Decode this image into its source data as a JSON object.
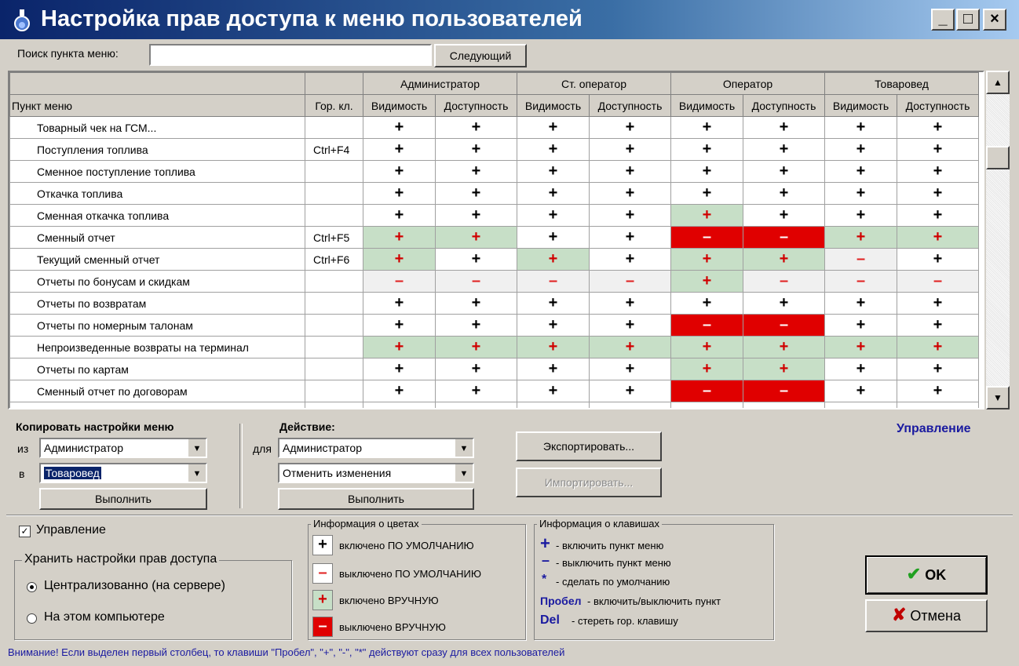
{
  "window": {
    "title": "Настройка прав доступа к меню пользователей",
    "min": "_",
    "max": "□",
    "close": "×"
  },
  "search": {
    "label": "Поиск пункта меню:",
    "value": "",
    "next_button": "Следующий"
  },
  "grid": {
    "col_item": "Пункт меню",
    "col_hotkey": "Гор. кл.",
    "groups": [
      "Администратор",
      "Ст. оператор",
      "Оператор",
      "Товаровед"
    ],
    "sub_vis": "Видимость",
    "sub_acc": "Доступность",
    "rows": [
      {
        "name": "Товарный чек на ГСМ...",
        "hotkey": "",
        "cells": [
          "d+",
          "d+",
          "d+",
          "d+",
          "d+",
          "d+",
          "d+",
          "d+"
        ]
      },
      {
        "name": "Поступления топлива",
        "hotkey": "Ctrl+F4",
        "cells": [
          "d+",
          "d+",
          "d+",
          "d+",
          "d+",
          "d+",
          "d+",
          "d+"
        ]
      },
      {
        "name": "Сменное поступление топлива",
        "hotkey": "",
        "cells": [
          "d+",
          "d+",
          "d+",
          "d+",
          "d+",
          "d+",
          "d+",
          "d+"
        ]
      },
      {
        "name": "Откачка топлива",
        "hotkey": "",
        "cells": [
          "d+",
          "d+",
          "d+",
          "d+",
          "d+",
          "d+",
          "d+",
          "d+"
        ]
      },
      {
        "name": "Сменная откачка топлива",
        "hotkey": "",
        "cells": [
          "d+",
          "d+",
          "d+",
          "d+",
          "m+",
          "d+",
          "d+",
          "d+"
        ]
      },
      {
        "name": "Сменный отчет",
        "hotkey": "Ctrl+F5",
        "cells": [
          "m+",
          "m+",
          "d+",
          "d+",
          "mm",
          "mm",
          "m+",
          "m+"
        ]
      },
      {
        "name": "Текущий сменный отчет",
        "hotkey": "Ctrl+F6",
        "cells": [
          "m+",
          "d+",
          "m+",
          "d+",
          "m+",
          "m+",
          "dm",
          "d+"
        ]
      },
      {
        "name": "Отчеты по бонусам и скидкам",
        "hotkey": "",
        "cells": [
          "dm",
          "dm",
          "dm",
          "dm",
          "m+",
          "dm",
          "dm",
          "dm"
        ]
      },
      {
        "name": "Отчеты по возвратам",
        "hotkey": "",
        "cells": [
          "d+",
          "d+",
          "d+",
          "d+",
          "d+",
          "d+",
          "d+",
          "d+"
        ]
      },
      {
        "name": "Отчеты по номерным талонам",
        "hotkey": "",
        "cells": [
          "d+",
          "d+",
          "d+",
          "d+",
          "mm",
          "mm",
          "d+",
          "d+"
        ]
      },
      {
        "name": "Непроизведенные возвраты на терминал",
        "hotkey": "",
        "cells": [
          "m+",
          "m+",
          "m+",
          "m+",
          "m+",
          "m+",
          "m+",
          "m+"
        ]
      },
      {
        "name": "Отчеты по картам",
        "hotkey": "",
        "cells": [
          "d+",
          "d+",
          "d+",
          "d+",
          "m+",
          "m+",
          "d+",
          "d+"
        ]
      },
      {
        "name": "Сменный отчет по договорам",
        "hotkey": "",
        "cells": [
          "d+",
          "d+",
          "d+",
          "d+",
          "mm",
          "mm",
          "d+",
          "d+"
        ]
      },
      {
        "name": "",
        "hotkey": "",
        "cells": [
          "",
          "",
          "",
          "",
          "",
          "",
          "",
          ""
        ]
      }
    ]
  },
  "copy": {
    "title": "Копировать настройки меню",
    "from_label": "из",
    "from_value": "Администратор",
    "to_label": "в",
    "to_value": "Товаровед",
    "run": "Выполнить"
  },
  "action": {
    "title": "Действие:",
    "for_label": "для",
    "for_value": "Администратор",
    "action_value": "Отменить изменения",
    "run": "Выполнить"
  },
  "export_button": "Экспортировать...",
  "import_button": "Импортировать...",
  "manage_link": "Управление",
  "manage_check": {
    "label": "Управление",
    "checked": true
  },
  "storage": {
    "title": "Хранить настройки прав доступа",
    "opt1": "Централизованно (на сервере)",
    "opt2": "На этом компьютере"
  },
  "colors": {
    "title": "Информация о цветах",
    "i1": "включено ПО УМОЛЧАНИЮ",
    "i2": "выключено ПО УМОЛЧАНИЮ",
    "i3": "включено ВРУЧНУЮ",
    "i4": "выключено ВРУЧНУЮ"
  },
  "keys": {
    "title": "Информация о клавишах",
    "k1": "+",
    "t1": "- включить пункт меню",
    "k2": "–",
    "t2": "- выключить пункт меню",
    "k3": "*",
    "t3": "- сделать по умолчанию",
    "k4": "Пробел",
    "t4": "- включить/выключить пункт",
    "k5": "Del",
    "t5": "- стереть гор. клавишу"
  },
  "ok_button": "OK",
  "cancel_button": "Отмена",
  "warning": "Внимание! Если выделен первый столбец, то клавиши \"Пробел\", \"+\", \"-\", \"*\" действуют сразу для всех пользователей",
  "palette": {
    "title_blue": "#0a246a",
    "manual_green": "#c7dfc7",
    "manual_off_red": "#e00000",
    "default_off_gray": "#f0f0f0",
    "minus_red": "#e02020",
    "link_blue": "#1a1aa0"
  }
}
